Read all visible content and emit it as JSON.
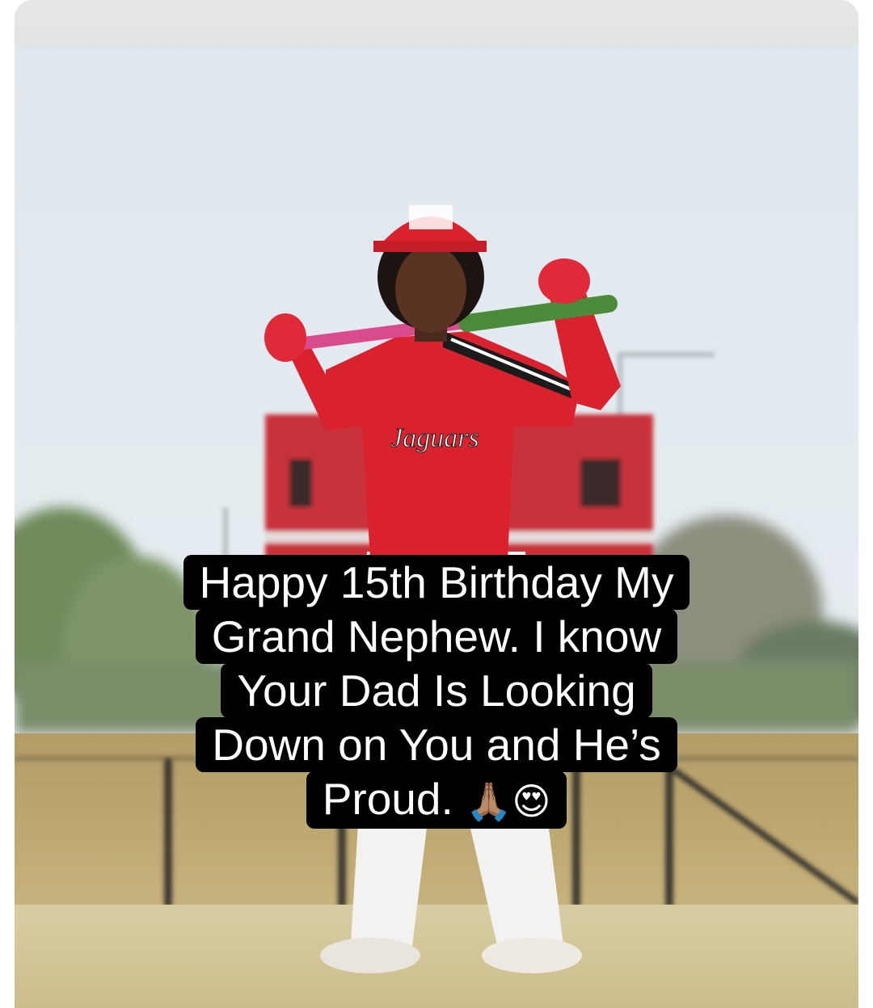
{
  "caption": {
    "lines": [
      "Happy 15th Birthday My",
      "Grand Nephew. I know",
      "Your Dad Is Looking",
      "Down on You and He’s",
      "Proud."
    ],
    "emoji_1": "🙏🏽",
    "emoji_2": "😍"
  },
  "photo": {
    "subject": "young baseball player in red jersey holding bat behind shoulders",
    "jersey_script": "Jaguars",
    "colors": {
      "sky": "#dfe9ef",
      "jersey": "#d9222e",
      "field_grass": "#b9a36c",
      "scoreboard": "#c9323a",
      "caption_bg": "#000000",
      "caption_text": "#ffffff"
    }
  }
}
